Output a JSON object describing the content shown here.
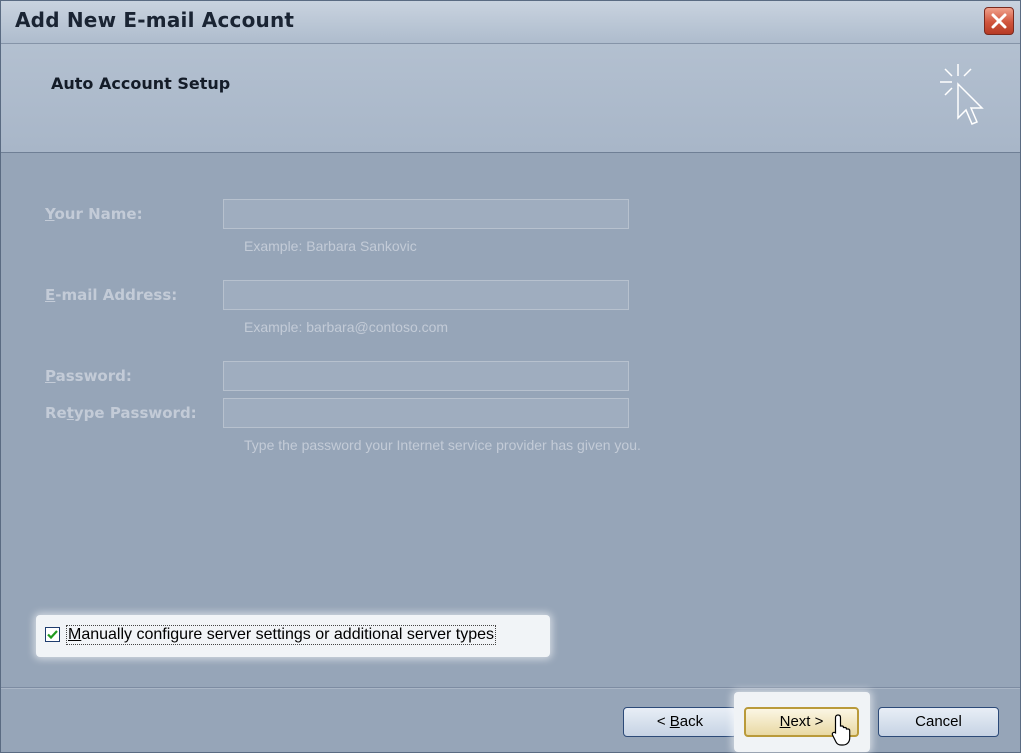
{
  "window": {
    "title": "Add New E-mail Account"
  },
  "header": {
    "title": "Auto Account Setup"
  },
  "form": {
    "name": {
      "label_first": "Y",
      "label_rest": "our Name:",
      "value": "",
      "hint": "Example: Barbara Sankovic"
    },
    "email": {
      "label_first": "E",
      "label_rest": "-mail Address:",
      "value": "",
      "hint": "Example: barbara@contoso.com"
    },
    "password": {
      "label_first": "P",
      "label_rest": "assword:",
      "value": ""
    },
    "retype": {
      "label_pre": "Re",
      "label_ul": "t",
      "label_post": "ype Password:",
      "value": "",
      "hint": "Type the password your Internet service provider has given you."
    }
  },
  "manual_config": {
    "checked": true,
    "label_first": "M",
    "label_rest": "anually configure server settings or additional server types"
  },
  "buttons": {
    "back": {
      "pre": "< ",
      "ul": "B",
      "post": "ack"
    },
    "next": {
      "ul": "N",
      "post": "ext >"
    },
    "cancel": "Cancel"
  }
}
